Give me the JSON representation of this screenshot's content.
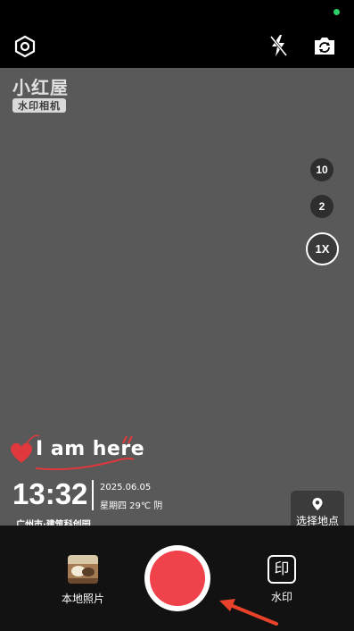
{
  "brand": {
    "logo_text": "小红屋",
    "subtitle": "水印相机"
  },
  "zoom": {
    "levels": [
      "10",
      "2",
      "1X"
    ],
    "active": "1X"
  },
  "watermark": {
    "headline": "I am here",
    "time": "13:32",
    "date": "2025.06.05",
    "weather": "星期四 29℃ 阴",
    "location": "广州市·建筑科创园"
  },
  "location_button": {
    "label": "选择地点"
  },
  "bottom": {
    "gallery_label": "本地照片",
    "watermark_label": "水印",
    "watermark_icon_char": "印"
  },
  "colors": {
    "accent": "#f0424b",
    "status_dot": "#2bd26b",
    "annotation_arrow": "#e8432a"
  }
}
